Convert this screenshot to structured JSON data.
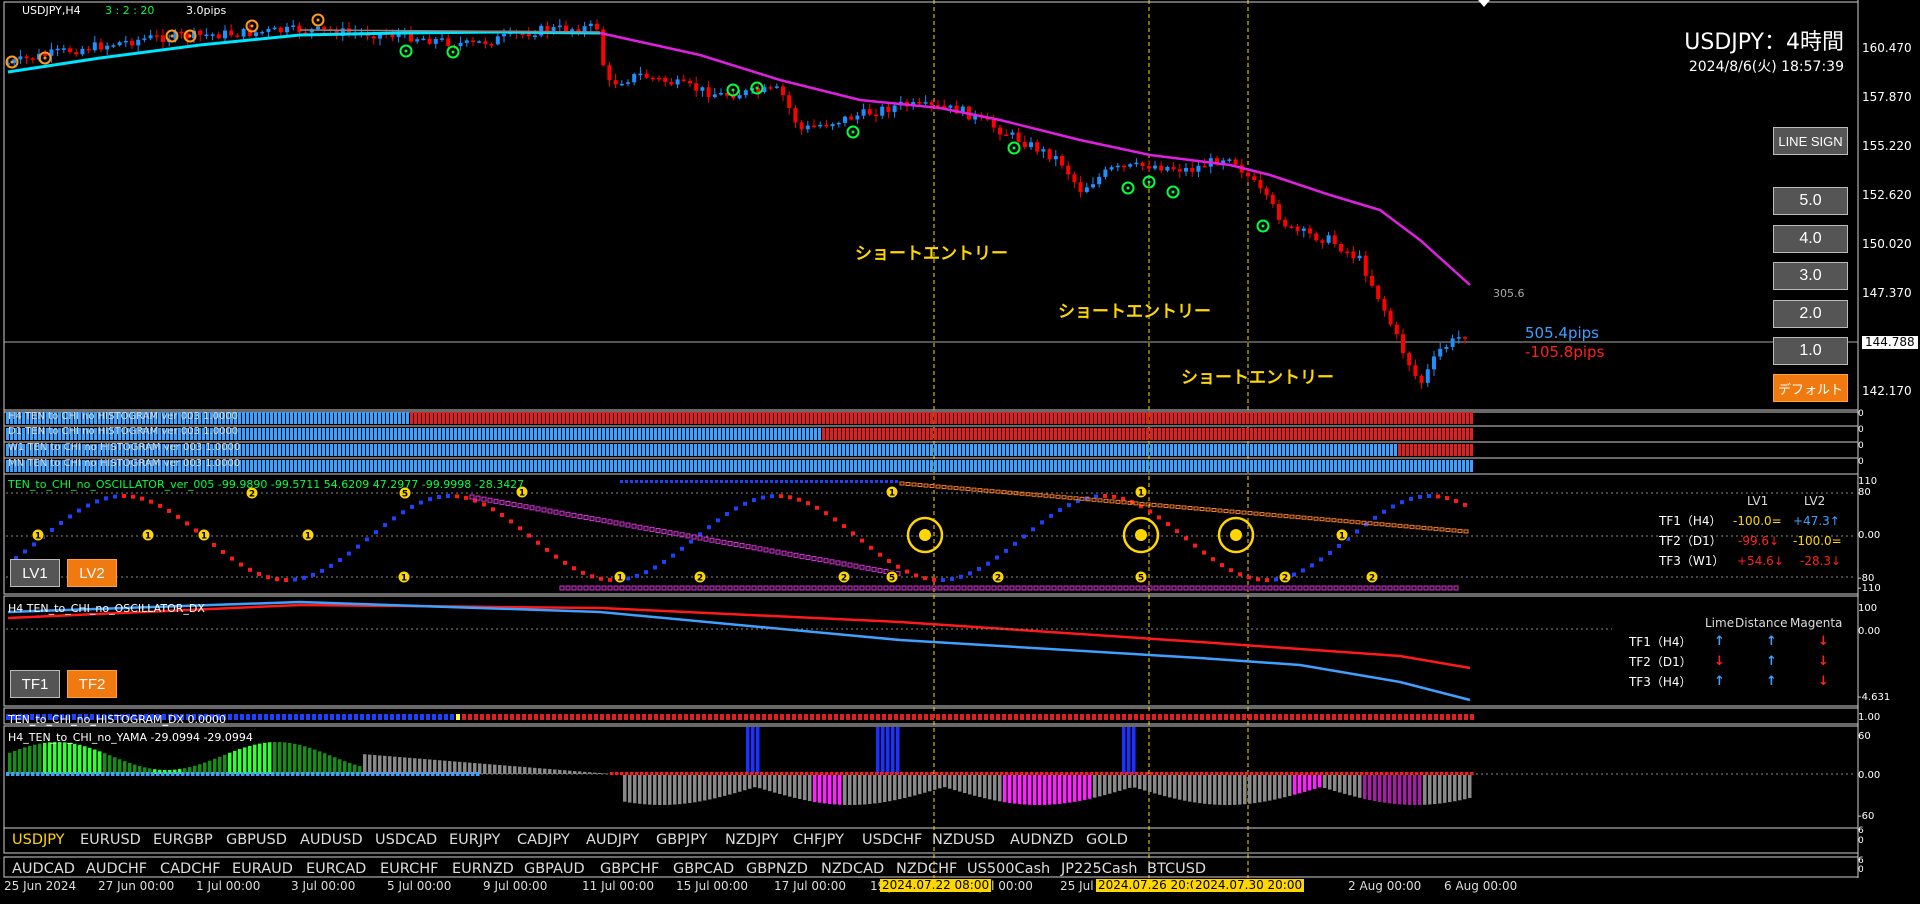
{
  "chart_header": {
    "symbol": "USDJPY,H4",
    "spread_counter": "3 : 2 : 20",
    "pips": "3.0pips"
  },
  "title": {
    "pair": "USDJPY：4時間",
    "datetime": "2024/8/6(火) 18:57:39"
  },
  "price_axis": [
    "160.470",
    "157.870",
    "155.220",
    "152.620",
    "150.020",
    "147.370",
    "144.788",
    "142.170"
  ],
  "annotations": {
    "entry1": "ショートエントリー",
    "entry2": "ショートエントリー",
    "entry3": "ショートエントリー",
    "ma_value": "305.6",
    "pips_plus": "505.4pips",
    "pips_minus": "-105.8pips"
  },
  "buttons": {
    "line_sign": "LINE SIGN",
    "l5": "5.0",
    "l4": "4.0",
    "l3": "3.0",
    "l2": "2.0",
    "l1": "1.0",
    "default": "デフォルト",
    "lv1": "LV1",
    "lv2": "LV2",
    "tf1": "TF1",
    "tf2": "TF2"
  },
  "histograms": [
    {
      "label": "H4 TEN to CHI no HISTOGRAM ver 003 1.0000",
      "axis": "0"
    },
    {
      "label": "D1 TEN to CHI no HISTOGRAM ver 003 1.0000",
      "axis": "0"
    },
    {
      "label": "W1 TEN to CHI no HISTOGRAM ver 003 1.0000",
      "axis": "0"
    },
    {
      "label": "MN TEN to CHI no HISTOGRAM ver 003 1.0000",
      "axis": "0"
    }
  ],
  "oscillator": {
    "label": "TEN_to_CHI_no_OSCILLATOR_ver_005 -99.9890 -99.5711 54.6209 47.2977 -99.9998 -28.3427",
    "axis": [
      "110",
      "80",
      "0.00",
      "-80",
      "-110"
    ],
    "header_lv1": "LV1",
    "header_lv2": "LV2",
    "rows": [
      {
        "tf": "TF1（H4）",
        "lv1": "-100.0=",
        "lv2": "+47.3↑"
      },
      {
        "tf": "TF2（D1）",
        "lv1": "-99.6↓",
        "lv2": "-100.0="
      },
      {
        "tf": "TF3（W1）",
        "lv1": "+54.6↓",
        "lv2": "-28.3↓"
      }
    ]
  },
  "dx": {
    "label": "H4 TEN_to_CHI_no_OSCILLATOR_DX",
    "axis": [
      "100",
      "0.00",
      "-4.631"
    ],
    "headers": [
      "Lime",
      "Distance",
      "Magenta"
    ],
    "rows": [
      {
        "tf": "TF1（H4）",
        "a": "↑",
        "b": "↑",
        "c": "↓"
      },
      {
        "tf": "TF2（D1）",
        "a": "↓",
        "b": "↑",
        "c": "↓"
      },
      {
        "tf": "TF3（H4）",
        "a": "↑",
        "b": "↑",
        "c": "↓"
      }
    ]
  },
  "hist_dx": {
    "label": "TEN_to_CHI_no_HISTOGRAM_DX 0.0000",
    "axis": "1.00"
  },
  "yama": {
    "label": "H4_TEN_to_CHI_no_YAMA -29.0994 -29.0994",
    "axis": [
      "60",
      "0.00",
      "-60"
    ]
  },
  "symbols_row1": [
    "USDJPY",
    "EURUSD",
    "EURGBP",
    "GBPUSD",
    "AUDUSD",
    "USDCAD",
    "EURJPY",
    "CADJPY",
    "AUDJPY",
    "GBPJPY",
    "NZDJPY",
    "CHFJPY",
    "USDCHF",
    "NZDUSD",
    "AUDNZD",
    "GOLD"
  ],
  "symbols_row2": [
    "AUDCAD",
    "AUDCHF",
    "CADCHF",
    "EURAUD",
    "EURCAD",
    "EURCHF",
    "EURNZD",
    "GBPAUD",
    "GBPCHF",
    "GBPCAD",
    "GBPNZD",
    "NZDCAD",
    "NZDCHF",
    "US500Cash",
    "JP225Cash",
    "BTCUSD"
  ],
  "symbols_axis": [
    "6",
    "0"
  ],
  "time_axis": [
    "25 Jun 2024",
    "27 Jun 00:00",
    "1 Jul 00:00",
    "3 Jul 00:00",
    "5 Jul 00:00",
    "9 Jul 00:00",
    "11 Jul 00:00",
    "15 Jul 00:00",
    "17 Jul 00:00",
    "19 Jul 00:00",
    "Jul 00:00",
    "25 Jul",
    "2 Aug 00:00",
    "6 Aug 00:00"
  ],
  "time_highlights": [
    "2024.07.22 08:00",
    "2024.07.26 20:00",
    "2024.07.30 20:00"
  ],
  "colors": {
    "bull": "#1e90ff",
    "bear": "#ff0000",
    "ma_fast": "#00e5ff",
    "ma_slow": "#e020e0",
    "signal": "#ffd700",
    "accent": "#f07a10"
  }
}
